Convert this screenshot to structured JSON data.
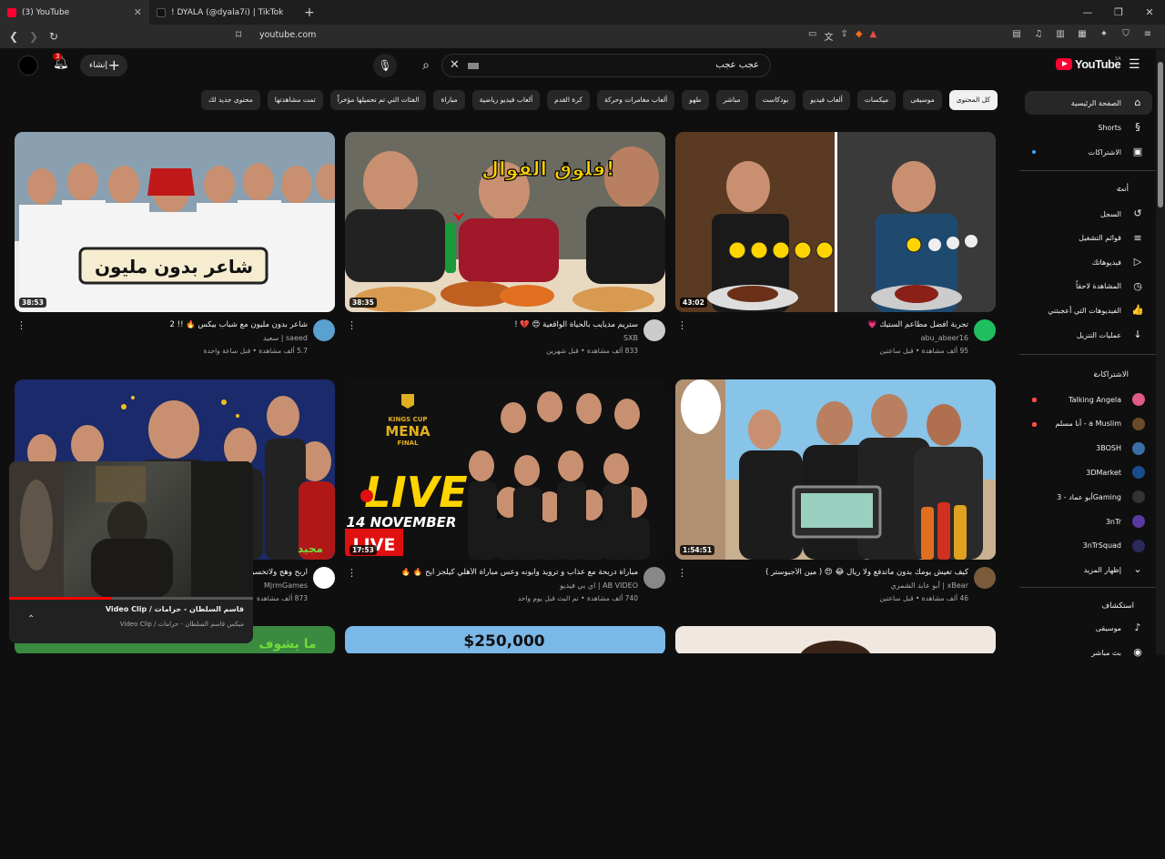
{
  "browser": {
    "tabs": [
      {
        "title": "(3) YouTube",
        "active": true
      },
      {
        "title": "! DYALA (@dyala7i) | TikTok",
        "active": false
      }
    ],
    "url": "youtube.com"
  },
  "header": {
    "logo_text": "YouTube",
    "logo_sup": "SA",
    "search_value": "عجب عجب",
    "create_label": "إنشاء",
    "notifications_count": "3"
  },
  "chips": [
    "كل المحتوى",
    "موسيقى",
    "ميكسات",
    "ألعاب فيديو",
    "بودكاست",
    "مباشر",
    "طهو",
    "ألعاب مغامرات وحركة",
    "كرة القدم",
    "ألعاب فيديو رياضية",
    "مباراة",
    "الفئات التي تم تحميلها مؤخراً",
    "تمت مشاهدتها",
    "محتوى جديد لك"
  ],
  "sidebar": {
    "main": [
      {
        "label": "الصفحة الرئيسية",
        "icon": "home-icon",
        "glyph": "⌂"
      },
      {
        "label": "Shorts",
        "icon": "shorts-icon",
        "glyph": "§"
      },
      {
        "label": "الاشتراكات",
        "icon": "subscriptions-icon",
        "glyph": "▣"
      }
    ],
    "you_header": "أنت",
    "you": [
      {
        "label": "السجل",
        "icon": "history-icon",
        "glyph": "↺"
      },
      {
        "label": "قوائم التشغيل",
        "icon": "playlists-icon",
        "glyph": "≡"
      },
      {
        "label": "فيديوهاتك",
        "icon": "your-videos-icon",
        "glyph": "▷"
      },
      {
        "label": "المشاهدة لاحقاً",
        "icon": "watch-later-icon",
        "glyph": "◷"
      },
      {
        "label": "الفيديوهات التي أعجبتني",
        "icon": "liked-icon",
        "glyph": "👍"
      },
      {
        "label": "عمليات التنزيل",
        "icon": "download-icon",
        "glyph": "↓"
      }
    ],
    "subs_header": "الاشتراكات",
    "subs": [
      {
        "label": "Talking Angela",
        "color": "#e05a8a",
        "dot": "red"
      },
      {
        "label": "أنا مسلم - a Muslim",
        "color": "#6b4a2a",
        "dot": "red"
      },
      {
        "label": "3BOSH",
        "color": "#3a6ea5",
        "dot": ""
      },
      {
        "label": "3DMarket",
        "color": "#1a4d8c",
        "dot": ""
      },
      {
        "label": "أبو عماد - 3Gaming",
        "color": "#333333",
        "dot": ""
      },
      {
        "label": "3nTr",
        "color": "#5a3aa0",
        "dot": ""
      },
      {
        "label": "3nTrSquad",
        "color": "#2a2a5a",
        "dot": ""
      }
    ],
    "show_more": "إظهار المزيد",
    "explore_header": "استكشاف",
    "explore": [
      {
        "label": "موسيقى",
        "icon": "music-icon",
        "glyph": "♪"
      },
      {
        "label": "بث مباشر",
        "icon": "live-icon",
        "glyph": "◉"
      }
    ]
  },
  "videos": [
    {
      "title": "تجربة أفضل مطاعم الستيك 💗",
      "channel": "abu_abeer16",
      "meta": "95 ألف مشاهدة • قبل ساعتين",
      "duration": "43:02",
      "avatar_color": "#1fbf5f"
    },
    {
      "title": "ستريم مديايب بالحياة الواقعية 😍 💔 !",
      "channel": "SXB",
      "meta": "833 ألف مشاهدة • قبل شهرين",
      "duration": "38:35",
      "avatar_color": "#cccccc"
    },
    {
      "title": "شاعر بدون مليون مع شباب بيكس 🔥 !! 2",
      "channel": "سعيد | saeed",
      "meta": "5.7 ألف مشاهدة • قبل ساعة واحدة",
      "duration": "38:53",
      "avatar_color": "#5aa0d0"
    },
    {
      "title": "كيف تعيش يومك بدون ماتدفع ولا ريال 😂 😍 ( مين الأجبوستر )",
      "channel": "أبو عابد الشمري | xBear",
      "meta": "46 ألف مشاهدة • قبل ساعتين",
      "duration": "1:54:51",
      "avatar_color": "#7a5a3a"
    },
    {
      "title": "مباراة دربحة مع عذاب و ترويد وايونه وعس مباراة الأهلي كيلجز ايح 🔥 🔥",
      "channel": "اي بي فيديو | AB VIDEO",
      "meta": "740 ألف مشاهدة • تم البث قبل يوم واحد",
      "duration": "17:53",
      "avatar_color": "#888888"
    },
    {
      "title": "اربح وهج ولاتخسر",
      "channel": "MjrmGames",
      "meta": "873 ألف مشاهدة",
      "duration": "",
      "avatar_color": "#ffffff"
    }
  ],
  "thumb_texts": {
    "v1_banner": "شاعر بدون مليون",
    "v2_banner": "فلوق الفوال!",
    "v5_top": "KINGS CUP",
    "v5_mena": "MENA",
    "v5_final": "FINAL",
    "v5_live": "LIVE",
    "v5_date": "14 NOVEMBER",
    "v5_badge": "LIVE",
    "v8_amount": "$250,000",
    "v6_sticker": "مجيد",
    "mini_sticker": "ما يشوف"
  },
  "miniplayer": {
    "title": "قاسم السلطان - حرامات / Video Clip",
    "subtitle": "ميكس قاسم السلطان - حرامات / Video Clip",
    "progress": 0.42
  },
  "colors": {
    "accent": "#ff0033",
    "bg": "#0f0f0f",
    "chip": "#272727"
  }
}
